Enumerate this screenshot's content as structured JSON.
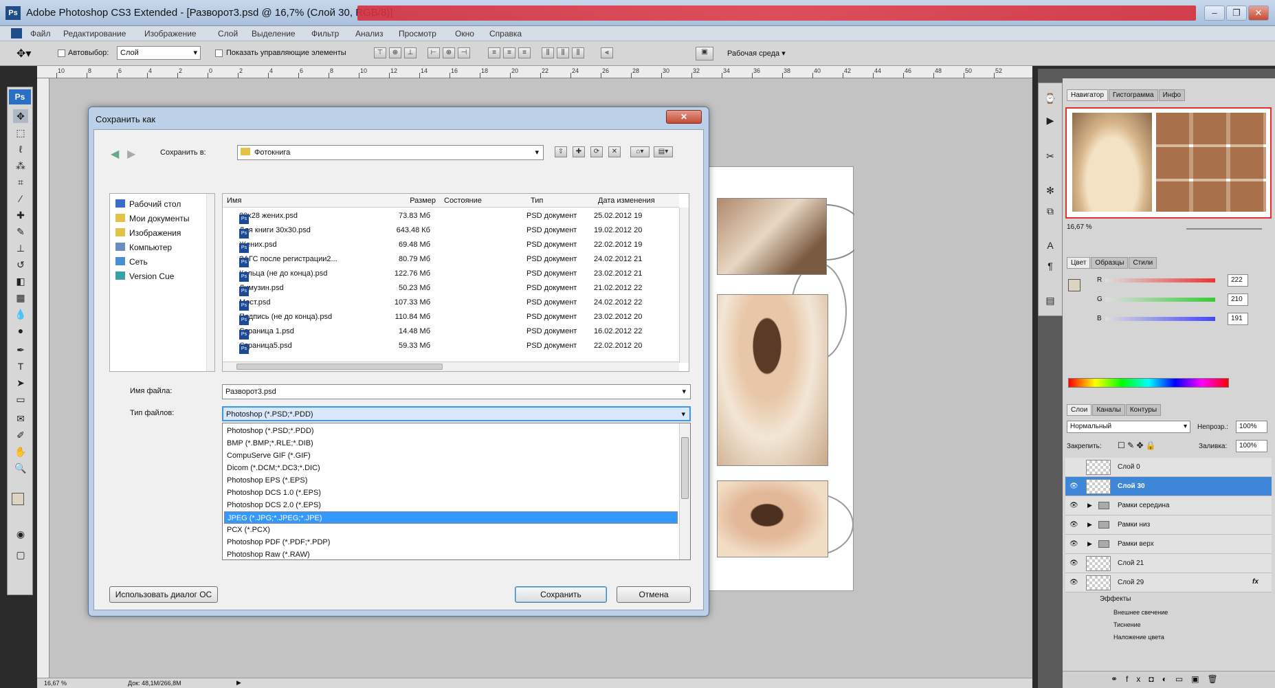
{
  "app": {
    "title": "Adobe Photoshop CS3 Extended - [Разворот3.psd @ 16,7% (Слой 30, RGB/8)]",
    "ps_badge": "Ps",
    "window_buttons": [
      "–",
      "❐",
      "✕"
    ]
  },
  "menu": [
    "Файл",
    "Редактирование",
    "Изображение",
    "Слой",
    "Выделение",
    "Фильтр",
    "Анализ",
    "Просмотр",
    "Окно",
    "Справка"
  ],
  "options": {
    "autoselect_label": "Автовыбор:",
    "autoselect_value": "Слой",
    "show_controls_label": "Показать управляющие элементы",
    "workspace_label": "Рабочая среда ▾"
  },
  "ruler_ticks": [
    "10",
    "8",
    "6",
    "4",
    "2",
    "0",
    "2",
    "4",
    "6",
    "8",
    "10",
    "12",
    "14",
    "16",
    "18",
    "20",
    "22",
    "24",
    "26",
    "28",
    "30",
    "32",
    "34",
    "36",
    "38",
    "40",
    "42",
    "44",
    "46",
    "48",
    "50",
    "52"
  ],
  "status": {
    "zoom": "16,67 %",
    "doc": "Док: 48,1M/266,8M"
  },
  "navigator": {
    "tabs": [
      "Навигатор",
      "Гистограмма",
      "Инфо"
    ],
    "zoom": "16,67 %"
  },
  "color_panel": {
    "tabs": [
      "Цвет",
      "Образцы",
      "Стили"
    ],
    "channels": [
      {
        "label": "R",
        "value": "222",
        "color": "#e33"
      },
      {
        "label": "G",
        "value": "210",
        "color": "#3c3"
      },
      {
        "label": "B",
        "value": "191",
        "color": "#44f"
      }
    ]
  },
  "layers_panel": {
    "tabs": [
      "Слои",
      "Каналы",
      "Контуры"
    ],
    "blend": "Нормальный",
    "opacity_label": "Непрозр.:",
    "opacity": "100%",
    "lock_label": "Закрепить:",
    "fill_label": "Заливка:",
    "fill": "100%",
    "layers": [
      {
        "name": "Слой 0",
        "type": "layer",
        "visible": false,
        "selected": false
      },
      {
        "name": "Слой 30",
        "type": "layer",
        "visible": true,
        "selected": true
      },
      {
        "name": "Рамки середина",
        "type": "group",
        "visible": true,
        "selected": false
      },
      {
        "name": "Рамки низ",
        "type": "group",
        "visible": true,
        "selected": false
      },
      {
        "name": "Рамки верх",
        "type": "group",
        "visible": true,
        "selected": false
      },
      {
        "name": "Слой 21",
        "type": "layer",
        "visible": true,
        "selected": false
      },
      {
        "name": "Слой 29",
        "type": "layer",
        "visible": true,
        "selected": false,
        "fx": "fx"
      }
    ],
    "effects_label": "Эффекты",
    "effects": [
      "Внешнее свечение",
      "Тиснение",
      "Наложение цвета"
    ]
  },
  "dialog": {
    "title": "Сохранить как",
    "close": "✕",
    "save_in_label": "Сохранить в:",
    "save_in_value": "Фотокнига",
    "places": [
      {
        "label": "Рабочий стол",
        "color": "#3a6fc4"
      },
      {
        "label": "Мои документы",
        "color": "#e3c24a"
      },
      {
        "label": "Изображения",
        "color": "#e3c24a"
      },
      {
        "label": "Компьютер",
        "color": "#6a8fbf"
      },
      {
        "label": "Сеть",
        "color": "#4a8fd6"
      },
      {
        "label": "Version Cue",
        "color": "#39a0a8"
      }
    ],
    "columns": [
      "Имя",
      "Размер",
      "Состояние",
      "Тип",
      "Дата изменения"
    ],
    "files": [
      {
        "name": "20x28 жених.psd",
        "size": "73.83 Мб",
        "type": "PSD документ",
        "date": "25.02.2012 19"
      },
      {
        "name": "Для книги 30x30.psd",
        "size": "643.48 Кб",
        "type": "PSD документ",
        "date": "19.02.2012 20"
      },
      {
        "name": "Жених.psd",
        "size": "69.48 Мб",
        "type": "PSD документ",
        "date": "22.02.2012 19"
      },
      {
        "name": "ЗАГС после регистрации2...",
        "size": "80.79 Мб",
        "type": "PSD документ",
        "date": "24.02.2012 21"
      },
      {
        "name": "Кольца (не до конца).psd",
        "size": "122.76 Мб",
        "type": "PSD документ",
        "date": "23.02.2012 21"
      },
      {
        "name": "Лимузин.psd",
        "size": "50.23 Мб",
        "type": "PSD документ",
        "date": "21.02.2012 22"
      },
      {
        "name": "Мост.psd",
        "size": "107.33 Мб",
        "type": "PSD документ",
        "date": "24.02.2012 22"
      },
      {
        "name": "Подпись (не до конца).psd",
        "size": "110.84 Мб",
        "type": "PSD документ",
        "date": "23.02.2012 20"
      },
      {
        "name": "Страница 1.psd",
        "size": "14.48 Мб",
        "type": "PSD документ",
        "date": "16.02.2012 22"
      },
      {
        "name": "Страница5.psd",
        "size": "59.33 Мб",
        "type": "PSD документ",
        "date": "22.02.2012 20"
      }
    ],
    "filename_label": "Имя файла:",
    "filename_value": "Разворот3.psd",
    "filetype_label": "Тип файлов:",
    "filetype_value": "Photoshop (*.PSD;*.PDD)",
    "filetypes": [
      "Photoshop (*.PSD;*.PDD)",
      "BMP (*.BMP;*.RLE;*.DIB)",
      "CompuServe GIF (*.GIF)",
      "Dicom (*.DCM;*.DC3;*.DIC)",
      "Photoshop EPS (*.EPS)",
      "Photoshop DCS 1.0 (*.EPS)",
      "Photoshop DCS 2.0 (*.EPS)",
      "JPEG (*.JPG;*.JPEG;*.JPE)",
      "PCX (*.PCX)",
      "Photoshop PDF (*.PDF;*.PDP)",
      "Photoshop Raw (*.RAW)"
    ],
    "selected_type_index": 7,
    "use_os_dialog": "Использовать диалог ОС",
    "save": "Сохранить",
    "cancel": "Отмена"
  }
}
